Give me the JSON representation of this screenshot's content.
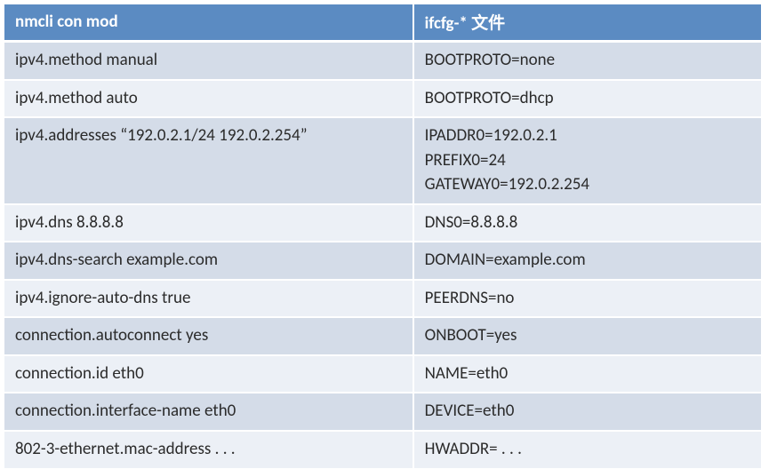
{
  "table": {
    "headers": [
      "nmcli con mod",
      "ifcfg-* 文件"
    ],
    "rows": [
      {
        "left": "ipv4.method manual",
        "right": "BOOTPROTO=none"
      },
      {
        "left": "ipv4.method auto",
        "right": "BOOTPROTO=dhcp"
      },
      {
        "left": "ipv4.addresses “192.0.2.1/24 192.0.2.254”",
        "right": "IPADDR0=192.0.2.1\nPREFIX0=24\nGATEWAY0=192.0.2.254"
      },
      {
        "left": "ipv4.dns 8.8.8.8",
        "right": "DNS0=8.8.8.8"
      },
      {
        "left": "ipv4.dns-search example.com",
        "right": "DOMAIN=example.com"
      },
      {
        "left": "ipv4.ignore-auto-dns true",
        "right": "PEERDNS=no"
      },
      {
        "left": "connection.autoconnect yes",
        "right": "ONBOOT=yes"
      },
      {
        "left": "connection.id eth0",
        "right": "NAME=eth0"
      },
      {
        "left": "connection.interface-name eth0",
        "right": "DEVICE=eth0"
      },
      {
        "left": "802-3-ethernet.mac-address . . .",
        "right": "HWADDR= . . ."
      }
    ]
  },
  "chart_data": {
    "type": "table",
    "title": "",
    "columns": [
      "nmcli con mod",
      "ifcfg-* 文件"
    ],
    "rows": [
      [
        "ipv4.method manual",
        "BOOTPROTO=none"
      ],
      [
        "ipv4.method auto",
        "BOOTPROTO=dhcp"
      ],
      [
        "ipv4.addresses “192.0.2.1/24 192.0.2.254”",
        "IPADDR0=192.0.2.1; PREFIX0=24; GATEWAY0=192.0.2.254"
      ],
      [
        "ipv4.dns 8.8.8.8",
        "DNS0=8.8.8.8"
      ],
      [
        "ipv4.dns-search example.com",
        "DOMAIN=example.com"
      ],
      [
        "ipv4.ignore-auto-dns true",
        "PEERDNS=no"
      ],
      [
        "connection.autoconnect yes",
        "ONBOOT=yes"
      ],
      [
        "connection.id eth0",
        "NAME=eth0"
      ],
      [
        "connection.interface-name eth0",
        "DEVICE=eth0"
      ],
      [
        "802-3-ethernet.mac-address . . .",
        "HWADDR= . . ."
      ]
    ]
  }
}
